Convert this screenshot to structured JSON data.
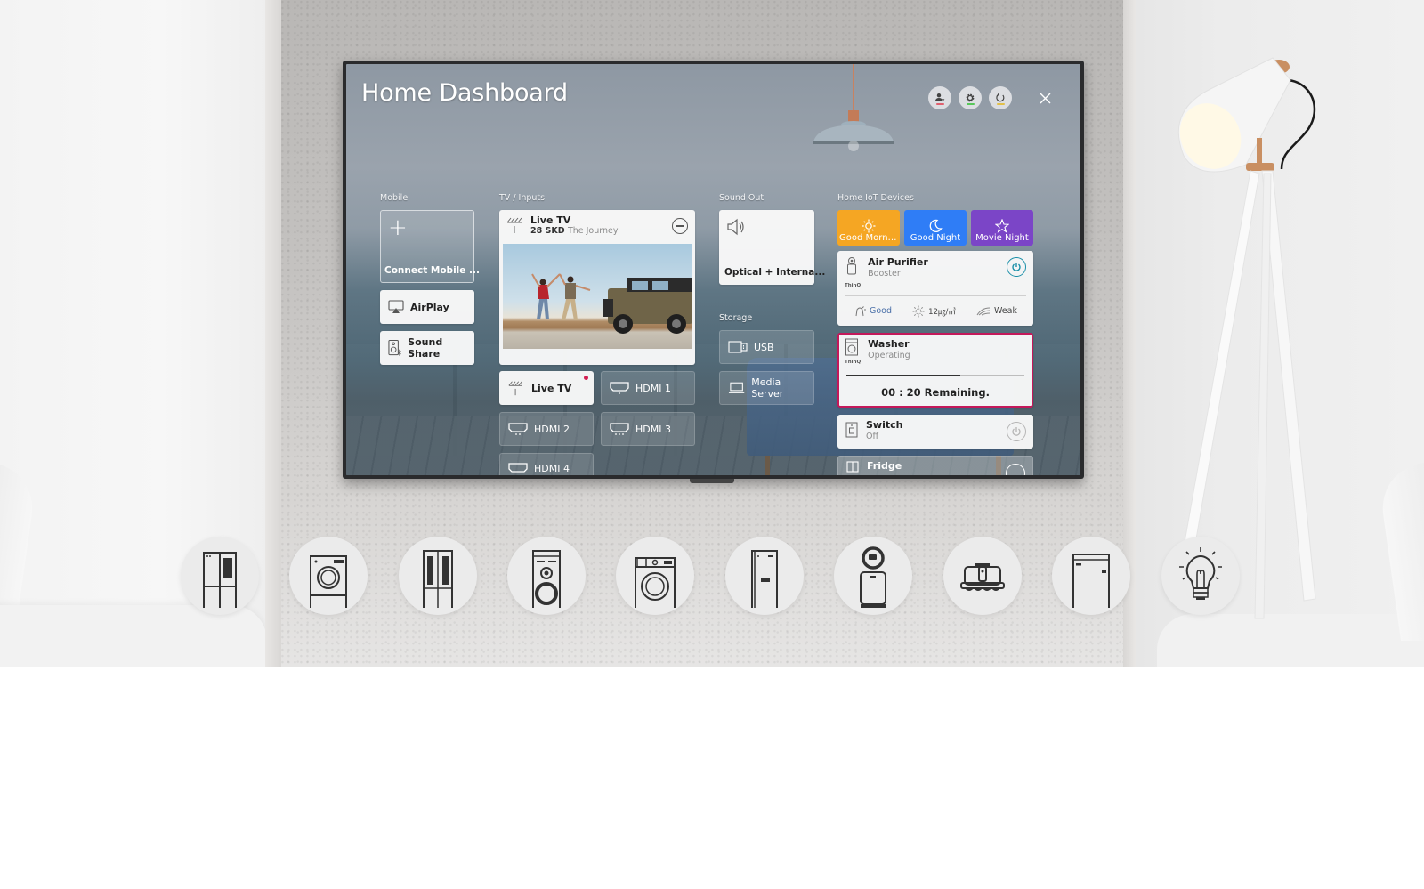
{
  "dashboard": {
    "title": "Home Dashboard",
    "top_actions": [
      {
        "icon": "user-account-icon",
        "indicator_color": "#e0606e"
      },
      {
        "icon": "gear-icon",
        "indicator_color": "#58c85a"
      },
      {
        "icon": "refresh-icon",
        "indicator_color": "#e2c04a"
      }
    ],
    "close_icon": "close-icon"
  },
  "sections": {
    "mobile": {
      "label": "Mobile",
      "connect_label": "Connect Mobile ...",
      "items": [
        {
          "label": "AirPlay",
          "icon": "airplay-icon"
        },
        {
          "label": "Sound Share",
          "icon": "speaker-bluetooth-icon"
        }
      ]
    },
    "tv_inputs": {
      "label": "TV / Inputs",
      "now_playing": {
        "source": "Live TV",
        "channel": "28 SKD",
        "program": "The Journey",
        "icon": "antenna-icon"
      },
      "inputs": [
        {
          "label": "Live TV",
          "icon": "antenna-icon",
          "active": true,
          "badge_color": "#d21f53"
        },
        {
          "label": "HDMI 1",
          "icon": "hdmi-icon",
          "active": false
        },
        {
          "label": "HDMI 2",
          "icon": "hdmi-icon",
          "active": false
        },
        {
          "label": "HDMI 3",
          "icon": "hdmi-icon",
          "active": false
        },
        {
          "label": "HDMI 4",
          "icon": "hdmi-icon",
          "active": false
        }
      ]
    },
    "sound_out": {
      "label": "Sound Out",
      "current": "Optical + Interna...",
      "icon": "speaker-icon"
    },
    "storage": {
      "label": "Storage",
      "items": [
        {
          "label": "USB",
          "icon": "usb-icon"
        },
        {
          "label": "Media Server",
          "icon": "laptop-icon"
        }
      ]
    },
    "iot": {
      "label": "Home IoT Devices",
      "scenes": [
        {
          "label": "Good Morni...",
          "icon": "sun-icon",
          "color": "#f5a623"
        },
        {
          "label": "Good Night",
          "icon": "moon-icon",
          "color": "#2f7df6"
        },
        {
          "label": "Movie Night",
          "icon": "star-icon",
          "color": "#7b45c7"
        }
      ],
      "devices": [
        {
          "name": "Air Purifier",
          "status": "Booster",
          "brand": "ThinQ",
          "power": "on",
          "metrics": [
            {
              "icon": "air-quality-icon",
              "value": "Good"
            },
            {
              "icon": "dust-icon",
              "value": "12㎍/㎥"
            },
            {
              "icon": "wind-icon",
              "value": "Weak"
            }
          ]
        },
        {
          "name": "Washer",
          "status": "Operating",
          "brand": "ThinQ",
          "progress": 0.64,
          "remaining": "00 : 20 Remaining.",
          "highlight_color": "#c4185a"
        },
        {
          "name": "Switch",
          "status": "Off",
          "power": "off"
        },
        {
          "name": "Fridge",
          "status": ""
        }
      ]
    }
  },
  "appliance_icons": [
    "refrigerator-icon",
    "washer-dryer-icon",
    "wine-cellar-fridge-icon",
    "speaker-tower-icon",
    "front-load-washer-icon",
    "tall-fridge-icon",
    "air-purifier-icon",
    "robot-vacuum-icon",
    "dishwasher-icon",
    "light-bulb-icon"
  ],
  "colors": {
    "accent_power": "#1a8fa8",
    "washer_border": "#c4185a"
  }
}
